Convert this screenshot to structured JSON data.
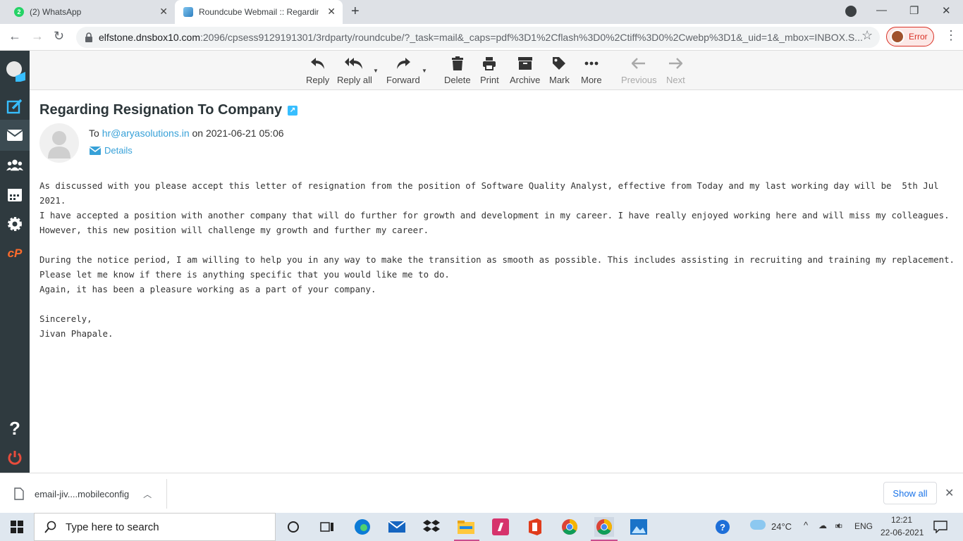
{
  "browser": {
    "tabs": [
      {
        "label": "(2) WhatsApp",
        "badge": "2"
      },
      {
        "label": "Roundcube Webmail :: Regarding"
      }
    ],
    "url_host": "elfstone.dnsbox10.com",
    "url_path": ":2096/cpsess9129191301/3rdparty/roundcube/?_task=mail&_caps=pdf%3D1%2Cflash%3D0%2Ctiff%3D0%2Cwebp%3D1&_uid=1&_mbox=INBOX.S...",
    "profile_status": "Error"
  },
  "toolbar": {
    "reply": "Reply",
    "reply_all": "Reply all",
    "forward": "Forward",
    "delete": "Delete",
    "print": "Print",
    "archive": "Archive",
    "mark": "Mark",
    "more": "More",
    "previous": "Previous",
    "next": "Next"
  },
  "message": {
    "subject": "Regarding Resignation To Company",
    "to_prefix": "To",
    "to_address": "hr@aryasolutions.in",
    "date_text": "on 2021-06-21 05:06",
    "details_label": "Details",
    "body": "As discussed with you please accept this letter of resignation from the position of Software Quality Analyst, effective from Today and my last working day will be  5th Jul 2021.\nI have accepted a position with another company that will do further for growth and development in my career. I have really enjoyed working here and will miss my colleagues. However, this new position will challenge my growth and further my career.\n\nDuring the notice period, I am willing to help you in any way to make the transition as smooth as possible. This includes assisting in recruiting and training my replacement. Please let me know if there is anything specific that you would like me to do.\nAgain, it has been a pleasure working as a part of your company.\n\nSincerely,\nJivan Phapale."
  },
  "downloads": {
    "file": "email-jiv....mobileconfig",
    "show_all": "Show all"
  },
  "taskbar": {
    "search_placeholder": "Type here to search",
    "weather": "24°C",
    "language": "ENG",
    "time": "12:21",
    "date": "22-06-2021"
  },
  "colors": {
    "sidebar": "#2f3a3f",
    "link": "#37a1d8",
    "accent": "#37beff"
  }
}
